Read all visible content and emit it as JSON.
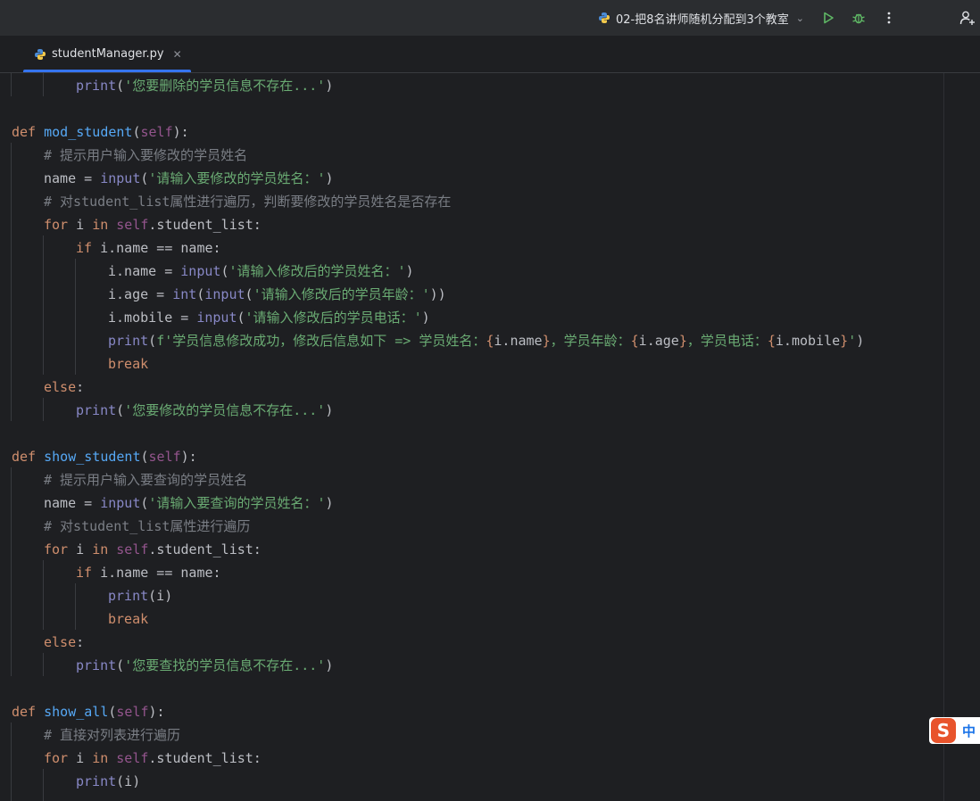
{
  "run_config": {
    "label": "02-把8名讲师随机分配到3个教室"
  },
  "tab": {
    "label": "studentManager.py"
  },
  "code": {
    "l0": {
      "print": "print",
      "open": "(",
      "str": "'您要删除的学员信息不存在...'",
      "close": ")"
    },
    "l2": {
      "def": "def",
      "name": "mod_student",
      "open": "(",
      "self": "self",
      "close": "):"
    },
    "l3": {
      "cmt": "# 提示用户输入要修改的学员姓名"
    },
    "l4": {
      "lhs": "name = ",
      "input": "input",
      "open": "(",
      "str": "'请输入要修改的学员姓名：'",
      "close": ")"
    },
    "l5": {
      "cmt": "# 对student_list属性进行遍历，判断要修改的学员姓名是否存在"
    },
    "l6": {
      "for": "for",
      "var": " i ",
      "in": "in",
      "sp": " ",
      "self": "self",
      "rest": ".student_list:"
    },
    "l7": {
      "if": "if",
      "rest": " i.name == name:"
    },
    "l8": {
      "lhs": "i.name = ",
      "input": "input",
      "open": "(",
      "str": "'请输入修改后的学员姓名：'",
      "close": ")"
    },
    "l9": {
      "lhs": "i.age = ",
      "int": "int",
      "open": "(",
      "input": "input",
      "open2": "(",
      "str": "'请输入修改后的学员年龄：'",
      "close": "))"
    },
    "l10": {
      "lhs": "i.mobile = ",
      "input": "input",
      "open": "(",
      "str": "'请输入修改后的学员电话：'",
      "close": ")"
    },
    "l11": {
      "print": "print",
      "open": "(",
      "s1": "f'学员信息修改成功，修改后信息如下 => 学员姓名：",
      "b1": "{",
      "e1": "i.name",
      "b2": "}",
      "s2": "，学员年龄：",
      "b3": "{",
      "e2": "i.age",
      "b4": "}",
      "s3": "，学员电话：",
      "b5": "{",
      "e3": "i.mobile",
      "b6": "}",
      "s4": "'",
      "close": ")"
    },
    "l12": {
      "break": "break"
    },
    "l13": {
      "else": "else",
      "colon": ":"
    },
    "l14": {
      "print": "print",
      "open": "(",
      "str": "'您要修改的学员信息不存在...'",
      "close": ")"
    },
    "l16": {
      "def": "def",
      "name": "show_student",
      "open": "(",
      "self": "self",
      "close": "):"
    },
    "l17": {
      "cmt": "# 提示用户输入要查询的学员姓名"
    },
    "l18": {
      "lhs": "name = ",
      "input": "input",
      "open": "(",
      "str": "'请输入要查询的学员姓名：'",
      "close": ")"
    },
    "l19": {
      "cmt": "# 对student_list属性进行遍历"
    },
    "l20": {
      "for": "for",
      "var": " i ",
      "in": "in",
      "sp": " ",
      "self": "self",
      "rest": ".student_list:"
    },
    "l21": {
      "if": "if",
      "rest": " i.name == name:"
    },
    "l22": {
      "print": "print",
      "rest": "(i)"
    },
    "l23": {
      "break": "break"
    },
    "l24": {
      "else": "else",
      "colon": ":"
    },
    "l25": {
      "print": "print",
      "open": "(",
      "str": "'您要查找的学员信息不存在...'",
      "close": ")"
    },
    "l27": {
      "def": "def",
      "name": "show_all",
      "open": "(",
      "self": "self",
      "close": "):"
    },
    "l28": {
      "cmt": "# 直接对列表进行遍历"
    },
    "l29": {
      "for": "for",
      "var": " i ",
      "in": "in",
      "sp": " ",
      "self": "self",
      "rest": ".student_list:"
    },
    "l30": {
      "print": "print",
      "rest": "(i)"
    }
  },
  "ime": {
    "logo": "S",
    "mode": "中"
  },
  "colors": {
    "accent": "#3574f0",
    "keyword": "#cf8e6d",
    "function": "#56a8f5",
    "self": "#94558d",
    "builtin": "#8888c6",
    "string": "#6aab73",
    "comment": "#7a7e85"
  }
}
